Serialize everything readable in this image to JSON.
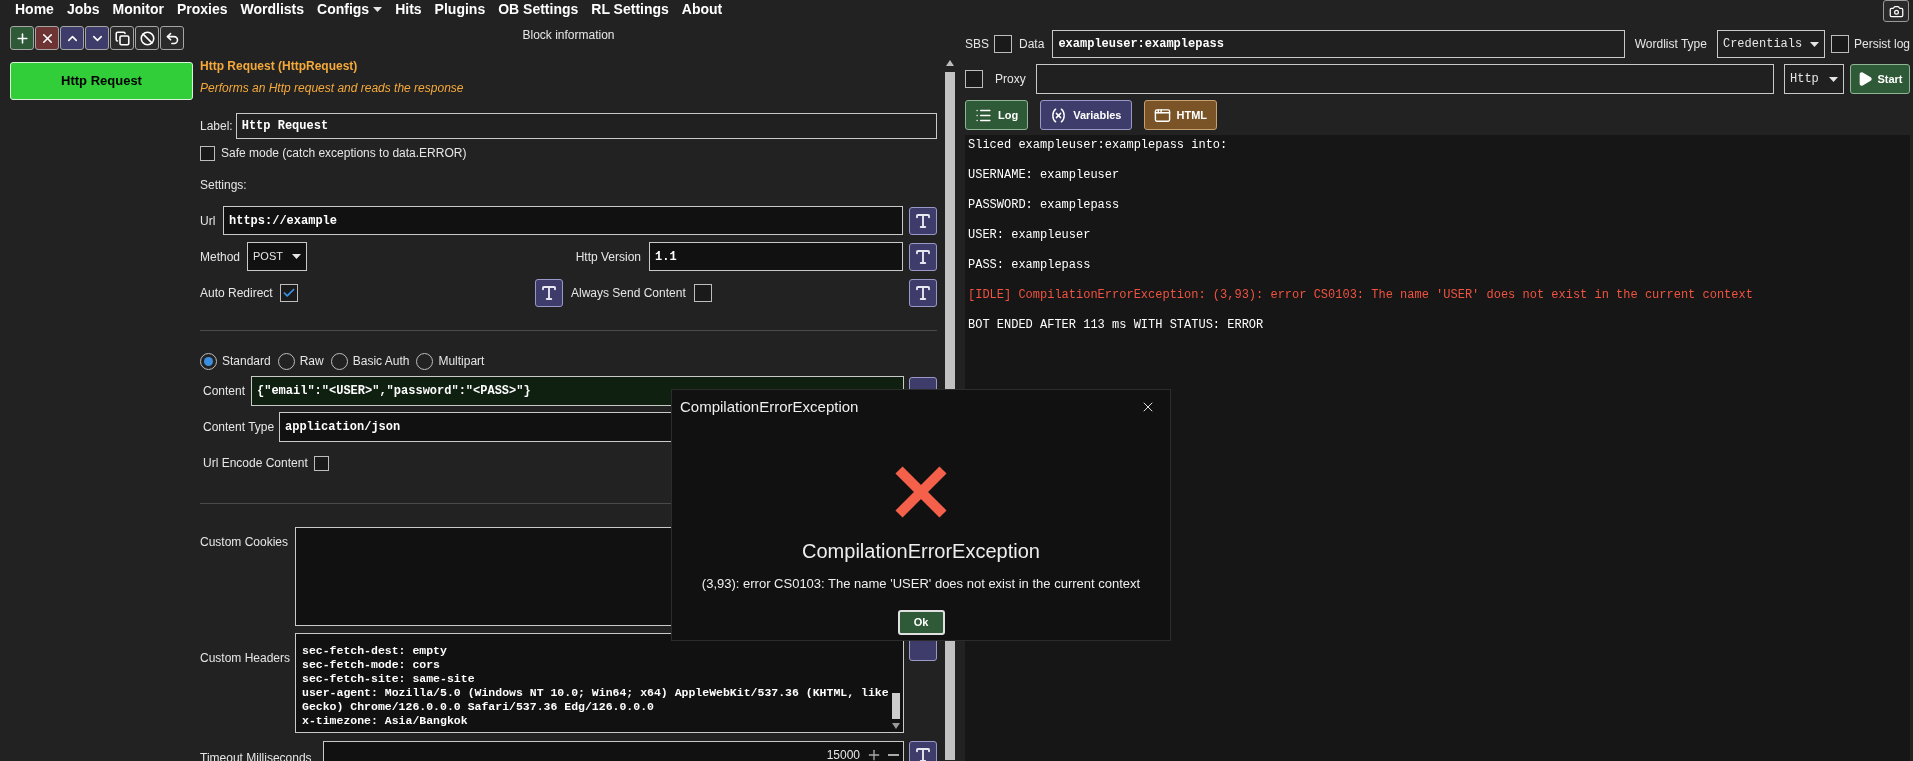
{
  "menu": [
    {
      "label": "Home",
      "dropdown": false
    },
    {
      "label": "Jobs",
      "dropdown": false
    },
    {
      "label": "Monitor",
      "dropdown": false
    },
    {
      "label": "Proxies",
      "dropdown": false
    },
    {
      "label": "Wordlists",
      "dropdown": false
    },
    {
      "label": "Configs",
      "dropdown": true
    },
    {
      "label": "Hits",
      "dropdown": false
    },
    {
      "label": "Plugins",
      "dropdown": false
    },
    {
      "label": "OB Settings",
      "dropdown": false
    },
    {
      "label": "RL Settings",
      "dropdown": false
    },
    {
      "label": "About",
      "dropdown": false
    }
  ],
  "blocks": [
    {
      "label": "Http Request",
      "selected": true
    }
  ],
  "block_info": {
    "heading": "Block information",
    "title": "Http Request (HttpRequest)",
    "description": "Performs an Http request and reads the response",
    "label_field": {
      "label": "Label:",
      "value": "Http Request"
    },
    "safe_mode": {
      "label": "Safe mode (catch exceptions to data.ERROR)",
      "checked": false
    },
    "settings_heading": "Settings:",
    "url": {
      "label": "Url",
      "value": "https://example"
    },
    "method": {
      "label": "Method",
      "value": "POST"
    },
    "http_version": {
      "label": "Http Version",
      "value": "1.1"
    },
    "auto_redirect": {
      "label": "Auto Redirect",
      "checked": true
    },
    "always_send_content": {
      "label": "Always Send Content",
      "checked": false
    },
    "content_modes": [
      {
        "label": "Standard",
        "selected": true
      },
      {
        "label": "Raw",
        "selected": false
      },
      {
        "label": "Basic Auth",
        "selected": false
      },
      {
        "label": "Multipart",
        "selected": false
      }
    ],
    "content": {
      "label": "Content",
      "value": "{\"email\":\"<USER>\",\"password\":\"<PASS>\"}"
    },
    "content_type": {
      "label": "Content Type",
      "value": "application/json"
    },
    "url_encode_content": {
      "label": "Url Encode Content",
      "checked": false
    },
    "custom_cookies": {
      "label": "Custom Cookies"
    },
    "custom_headers": {
      "label": "Custom Headers",
      "lines": [
        "sec-fetch-dest: empty",
        "sec-fetch-mode: cors",
        "sec-fetch-site: same-site",
        "user-agent: Mozilla/5.0 (Windows NT 10.0; Win64; x64) AppleWebKit/537.36 (KHTML, like Gecko) Chrome/126.0.0.0 Safari/537.36 Edg/126.0.0.0",
        "x-timezone: Asia/Bangkok"
      ]
    },
    "timeout": {
      "label": "Timeout Milliseconds",
      "value": "15000"
    }
  },
  "debugger": {
    "sbs": {
      "label": "SBS",
      "checked": false
    },
    "data": {
      "label": "Data",
      "value": "exampleuser:examplepass"
    },
    "wordlist_type": {
      "label": "Wordlist Type",
      "value": "Credentials"
    },
    "persist_log": {
      "label": "Persist log",
      "checked": false
    },
    "proxy": {
      "label": "Proxy",
      "checked": false
    },
    "proxy_type": {
      "value": "Http"
    },
    "start_button": "Start",
    "views": [
      {
        "kind": "log",
        "label": "Log"
      },
      {
        "kind": "variables",
        "label": "Variables"
      },
      {
        "kind": "html",
        "label": "HTML"
      }
    ],
    "log": [
      {
        "kind": "info",
        "text": "Sliced exampleuser:examplepass into:"
      },
      {
        "kind": "info",
        "text": "USERNAME: exampleuser"
      },
      {
        "kind": "info",
        "text": "PASSWORD: examplepass"
      },
      {
        "kind": "info",
        "text": "USER: exampleuser"
      },
      {
        "kind": "info",
        "text": "PASS: examplepass"
      },
      {
        "kind": "error",
        "text": "[IDLE] CompilationErrorException: (3,93): error CS0103: The name 'USER' does not exist in the current context"
      },
      {
        "kind": "info",
        "text": "BOT ENDED AFTER 113 ms WITH STATUS: ERROR"
      }
    ]
  },
  "dialog": {
    "title": "CompilationErrorException",
    "heading": "CompilationErrorException",
    "message": "(3,93): error CS0103: The name 'USER' does not exist in the current context",
    "button": "Ok"
  }
}
